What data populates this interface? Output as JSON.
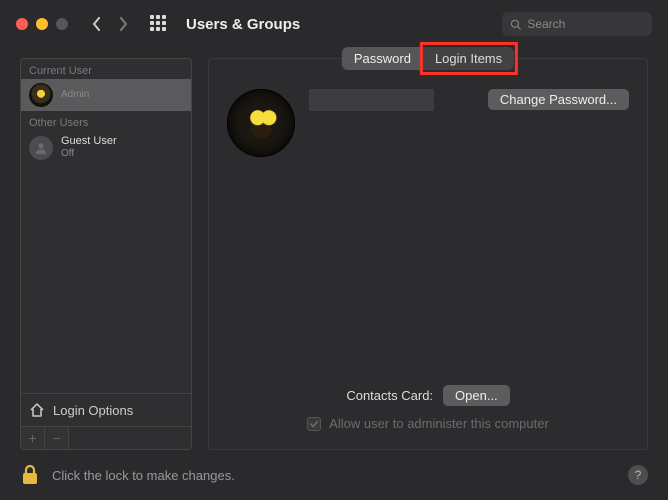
{
  "window": {
    "title": "Users & Groups",
    "search_placeholder": "Search"
  },
  "sidebar": {
    "current_head": "Current User",
    "other_head": "Other Users",
    "current_user": {
      "role": "Admin"
    },
    "guest_user": {
      "name": "Guest User",
      "status": "Off"
    },
    "login_options": "Login Options"
  },
  "tabs": {
    "password": "Password",
    "login_items": "Login Items"
  },
  "main": {
    "change_password": "Change Password...",
    "contacts_label": "Contacts Card:",
    "open": "Open...",
    "admin_checkbox": "Allow user to administer this computer"
  },
  "footer": {
    "lock_text": "Click the lock to make changes.",
    "help": "?"
  }
}
